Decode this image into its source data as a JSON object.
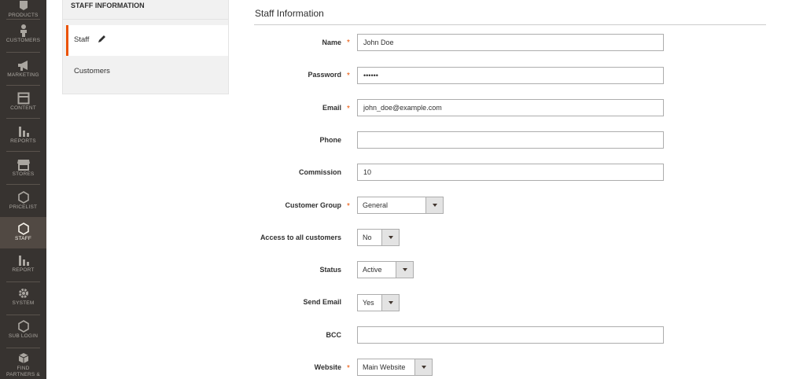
{
  "nav": {
    "items": [
      {
        "label": "PRODUCTS",
        "icon": "cube-icon"
      },
      {
        "label": "CUSTOMERS",
        "icon": "person-icon"
      },
      {
        "label": "MARKETING",
        "icon": "megaphone-icon"
      },
      {
        "label": "CONTENT",
        "icon": "layout-icon"
      },
      {
        "label": "REPORTS",
        "icon": "bar-chart-icon"
      },
      {
        "label": "STORES",
        "icon": "storefront-icon"
      },
      {
        "label": "PRICELIST",
        "icon": "hexagon-icon"
      },
      {
        "label": "STAFF",
        "icon": "hexagon-icon"
      },
      {
        "label": "REPORT",
        "icon": "bar-chart-icon"
      },
      {
        "label": "SYSTEM",
        "icon": "gear-icon"
      },
      {
        "label": "SUB LOGIN",
        "icon": "hexagon-icon"
      },
      {
        "label": "FIND PARTNERS &",
        "icon": "boxes-icon"
      }
    ],
    "active": "STAFF"
  },
  "tabs": {
    "title": "STAFF INFORMATION",
    "items": [
      {
        "label": "Staff",
        "active": true,
        "icon": "pencil-icon"
      },
      {
        "label": "Customers",
        "active": false
      }
    ]
  },
  "form": {
    "title": "Staff Information",
    "fields": {
      "name": {
        "label": "Name",
        "required": true,
        "value": "John Doe"
      },
      "password": {
        "label": "Password",
        "required": true,
        "value": "••••••"
      },
      "email": {
        "label": "Email",
        "required": true,
        "value": "john_doe@example.com"
      },
      "phone": {
        "label": "Phone",
        "required": false,
        "value": ""
      },
      "commission": {
        "label": "Commission",
        "required": false,
        "value": "10"
      },
      "customer_group": {
        "label": "Customer Group",
        "required": true,
        "value": "General"
      },
      "access_all": {
        "label": "Access to all customers",
        "required": false,
        "value": "No"
      },
      "status": {
        "label": "Status",
        "required": false,
        "value": "Active"
      },
      "send_email": {
        "label": "Send Email",
        "required": false,
        "value": "Yes"
      },
      "bcc": {
        "label": "BCC",
        "required": false,
        "value": ""
      },
      "website": {
        "label": "Website",
        "required": true,
        "value": "Main Website"
      }
    },
    "required_marker": "*"
  },
  "colors": {
    "nav_bg": "#373330",
    "nav_active": "#514943",
    "accent": "#eb5202",
    "border": "#adadad"
  }
}
